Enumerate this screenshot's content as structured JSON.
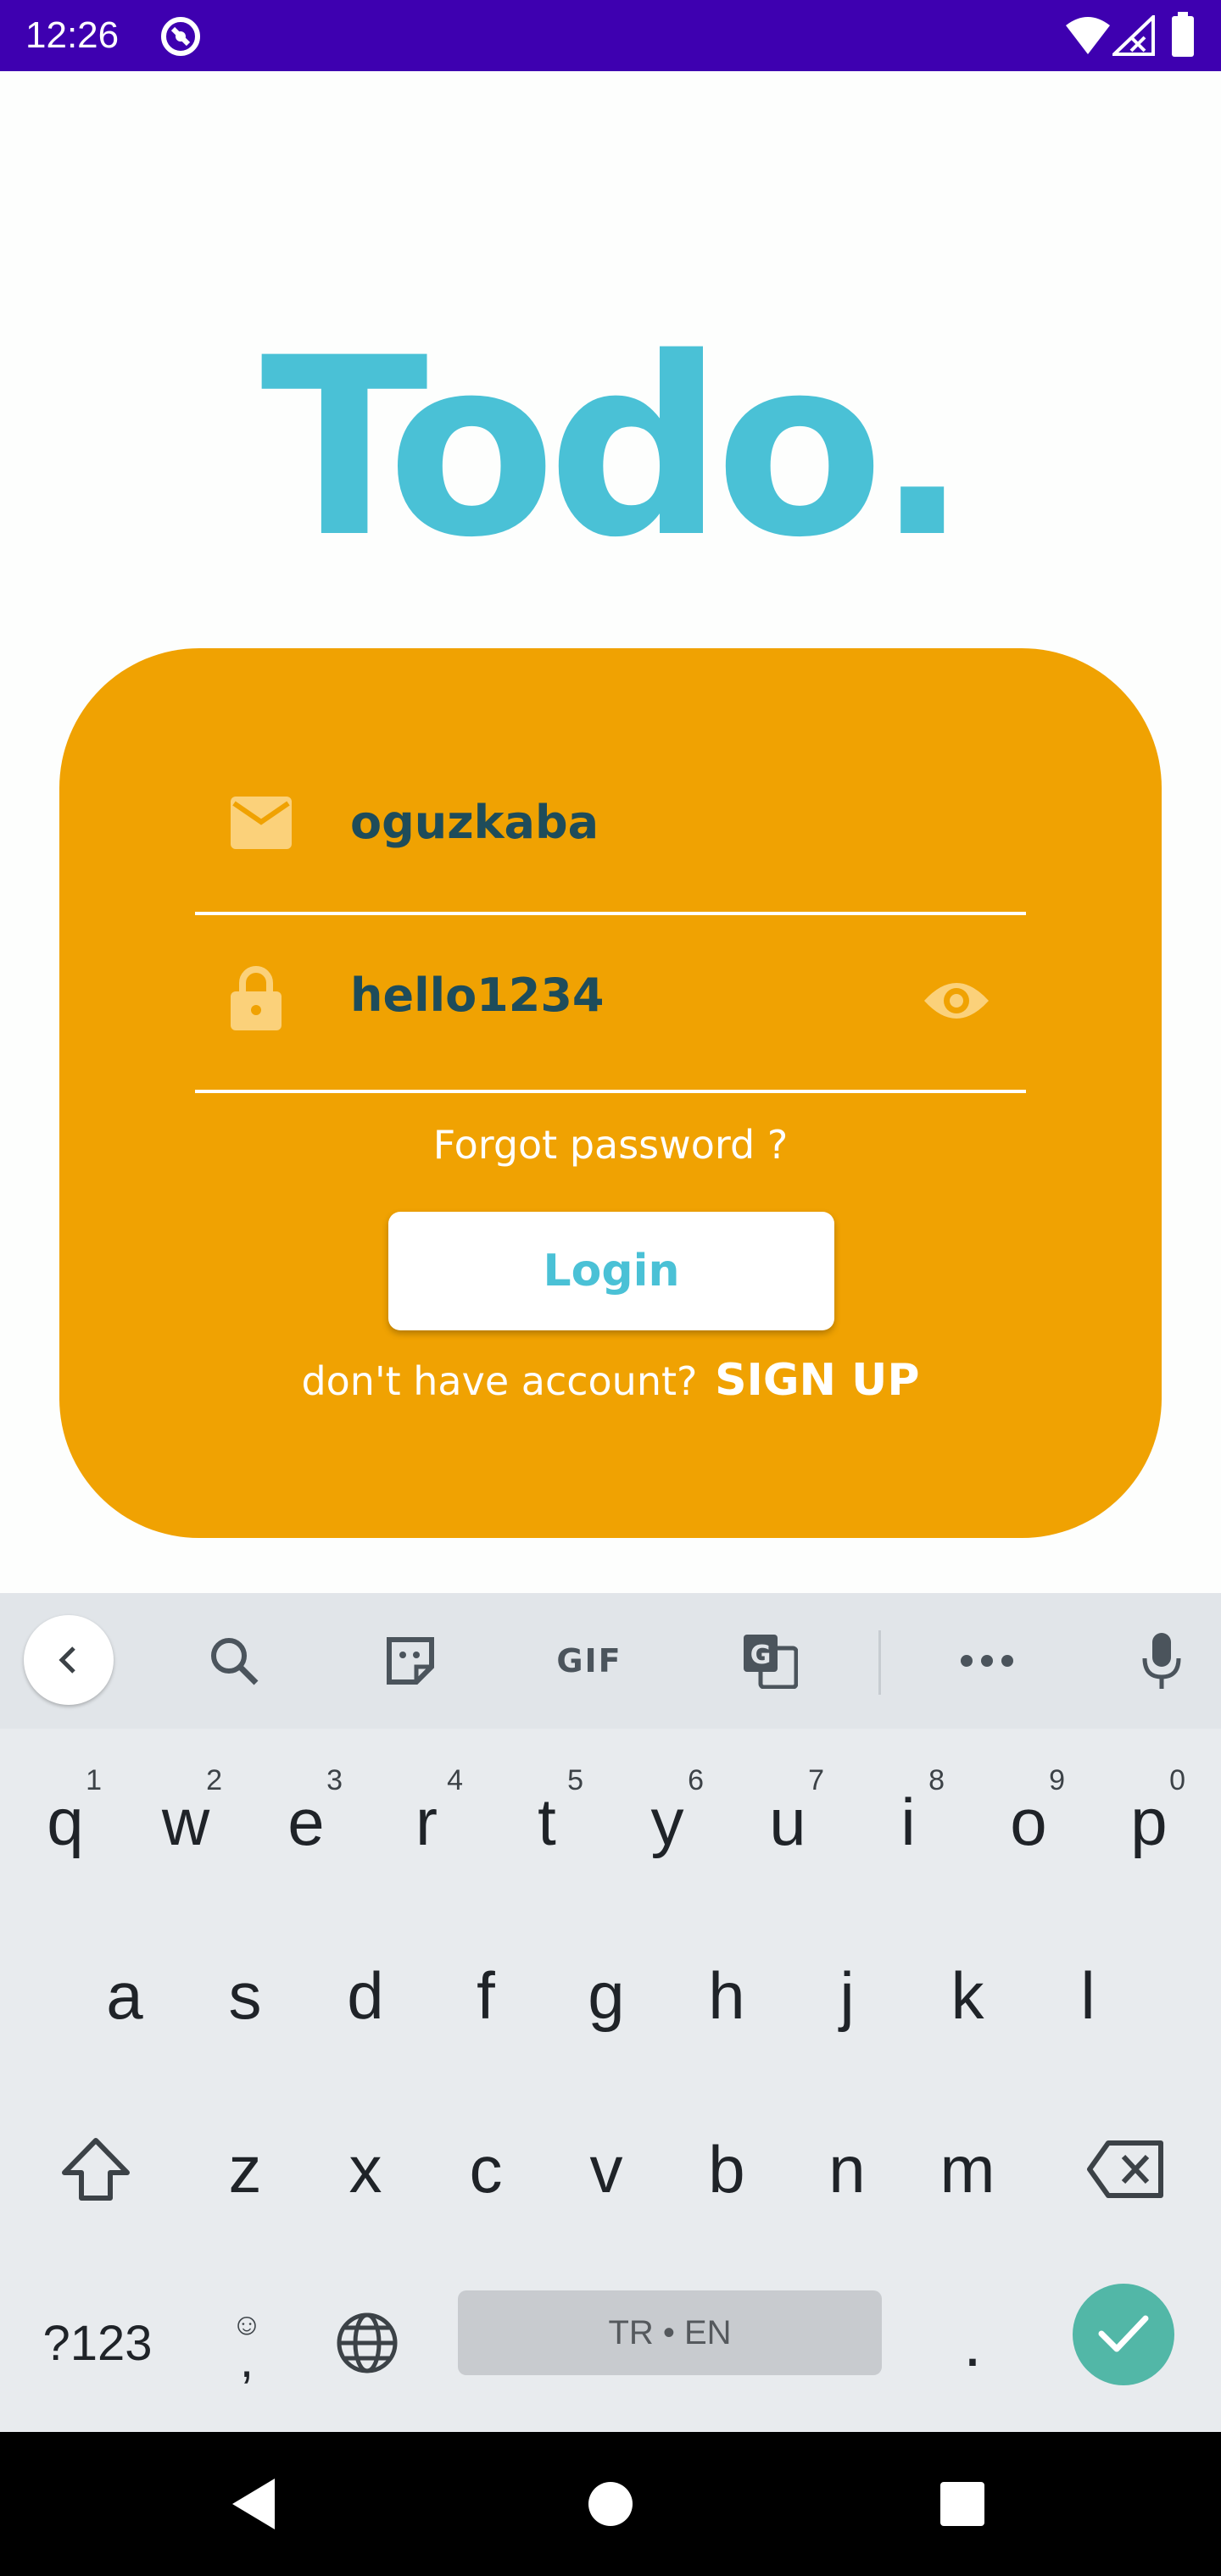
{
  "status_bar": {
    "time": "12:26",
    "icons": [
      "app-notification-icon",
      "wifi-icon",
      "signal-icon",
      "battery-icon"
    ],
    "background": "#3e00b0"
  },
  "app": {
    "title": "Todo.",
    "title_color": "#4ac1d6",
    "card_color": "#f0a202"
  },
  "login": {
    "email_value": "oguzkaba",
    "email_icon": "mail-icon",
    "password_value": "hello1234",
    "password_icon": "lock-icon",
    "password_toggle_icon": "eye-icon",
    "forgot_password": "Forgot password ?",
    "login_button": "Login",
    "no_account_text": "don't have account?",
    "signup_link": "SIGN UP"
  },
  "keyboard": {
    "toolbar": [
      "back-icon",
      "search-icon",
      "sticker-icon",
      "GIF",
      "translate-icon",
      "more-icon",
      "mic-icon"
    ],
    "gif_label": "GIF",
    "row1": [
      "q",
      "w",
      "e",
      "r",
      "t",
      "y",
      "u",
      "i",
      "o",
      "p"
    ],
    "row1_hints": [
      "1",
      "2",
      "3",
      "4",
      "5",
      "6",
      "7",
      "8",
      "9",
      "0"
    ],
    "row2": [
      "a",
      "s",
      "d",
      "f",
      "g",
      "h",
      "j",
      "k",
      "l"
    ],
    "row3": [
      "z",
      "x",
      "c",
      "v",
      "b",
      "n",
      "m"
    ],
    "symbols_key": "?123",
    "comma_key": ",",
    "period_key": ".",
    "space_label": "TR • EN",
    "enter_color": "#52b7a7"
  },
  "nav_bar": {
    "buttons": [
      "back-triangle-icon",
      "home-circle-icon",
      "recents-square-icon"
    ]
  }
}
